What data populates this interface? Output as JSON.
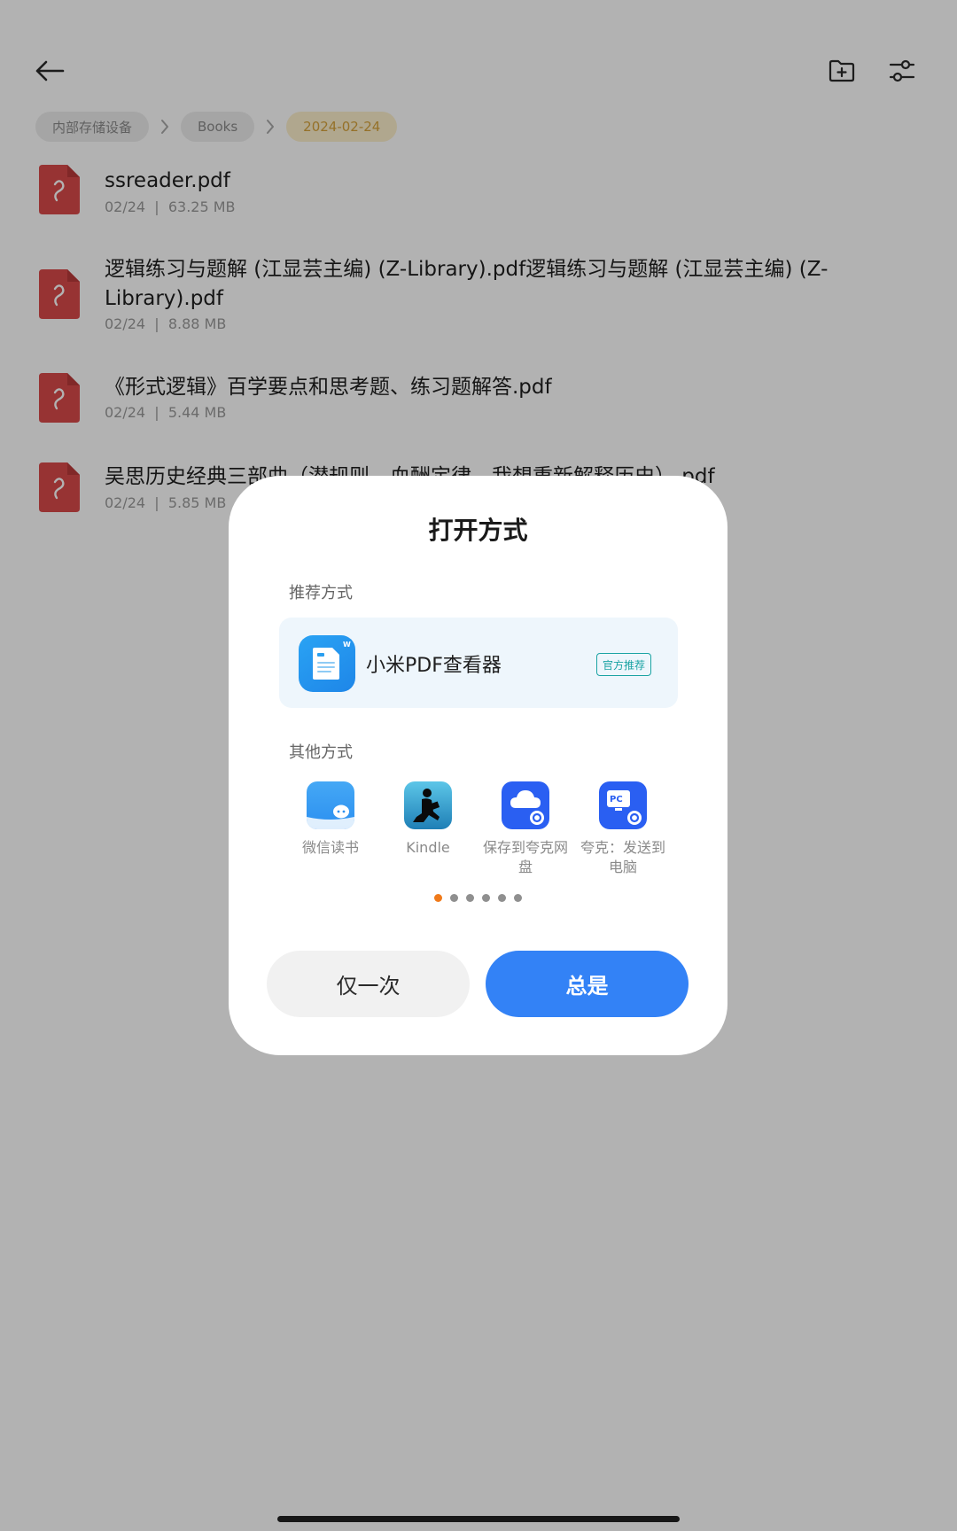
{
  "header": {
    "back_icon": "arrow-left-icon",
    "new_folder_icon": "folder-plus-icon",
    "filter_icon": "sliders-icon"
  },
  "breadcrumb": [
    {
      "label": "内部存储设备",
      "active": false
    },
    {
      "label": "Books",
      "active": false
    },
    {
      "label": "2024-02-24",
      "active": true
    }
  ],
  "files": [
    {
      "name": "ssreader.pdf",
      "date": "02/24",
      "size": "63.25 MB"
    },
    {
      "name": "逻辑练习与题解 (江显芸主编) (Z-Library).pdf逻辑练习与题解 (江显芸主编) (Z-Library).pdf",
      "date": "02/24",
      "size": "8.88 MB"
    },
    {
      "name": "《形式逻辑》百学要点和思考题、练习题解答.pdf",
      "date": "02/24",
      "size": "5.44 MB"
    },
    {
      "name": "吴思历史经典三部曲（潜规则、血酬定律、我想重新解释历史）.pdf",
      "date": "02/24",
      "size": "5.85 MB"
    }
  ],
  "dialog": {
    "title": "打开方式",
    "recommended_label": "推荐方式",
    "recommended_app": {
      "name": "小米PDF查看器",
      "badge": "官方推荐"
    },
    "other_label": "其他方式",
    "other_apps": [
      {
        "name": "微信读书",
        "icon": "weread-icon"
      },
      {
        "name": "Kindle",
        "icon": "kindle-icon"
      },
      {
        "name": "保存到夸克网盘",
        "icon": "quark-cloud-icon"
      },
      {
        "name": "夸克：发送到电脑",
        "icon": "quark-pc-icon"
      }
    ],
    "page_count": 6,
    "active_page": 0,
    "once_label": "仅一次",
    "always_label": "总是"
  },
  "colors": {
    "accent": "#3382f6",
    "pdf_icon": "#d94a4a",
    "badge": "#1aa3a3",
    "active_dot": "#f07a1a"
  }
}
